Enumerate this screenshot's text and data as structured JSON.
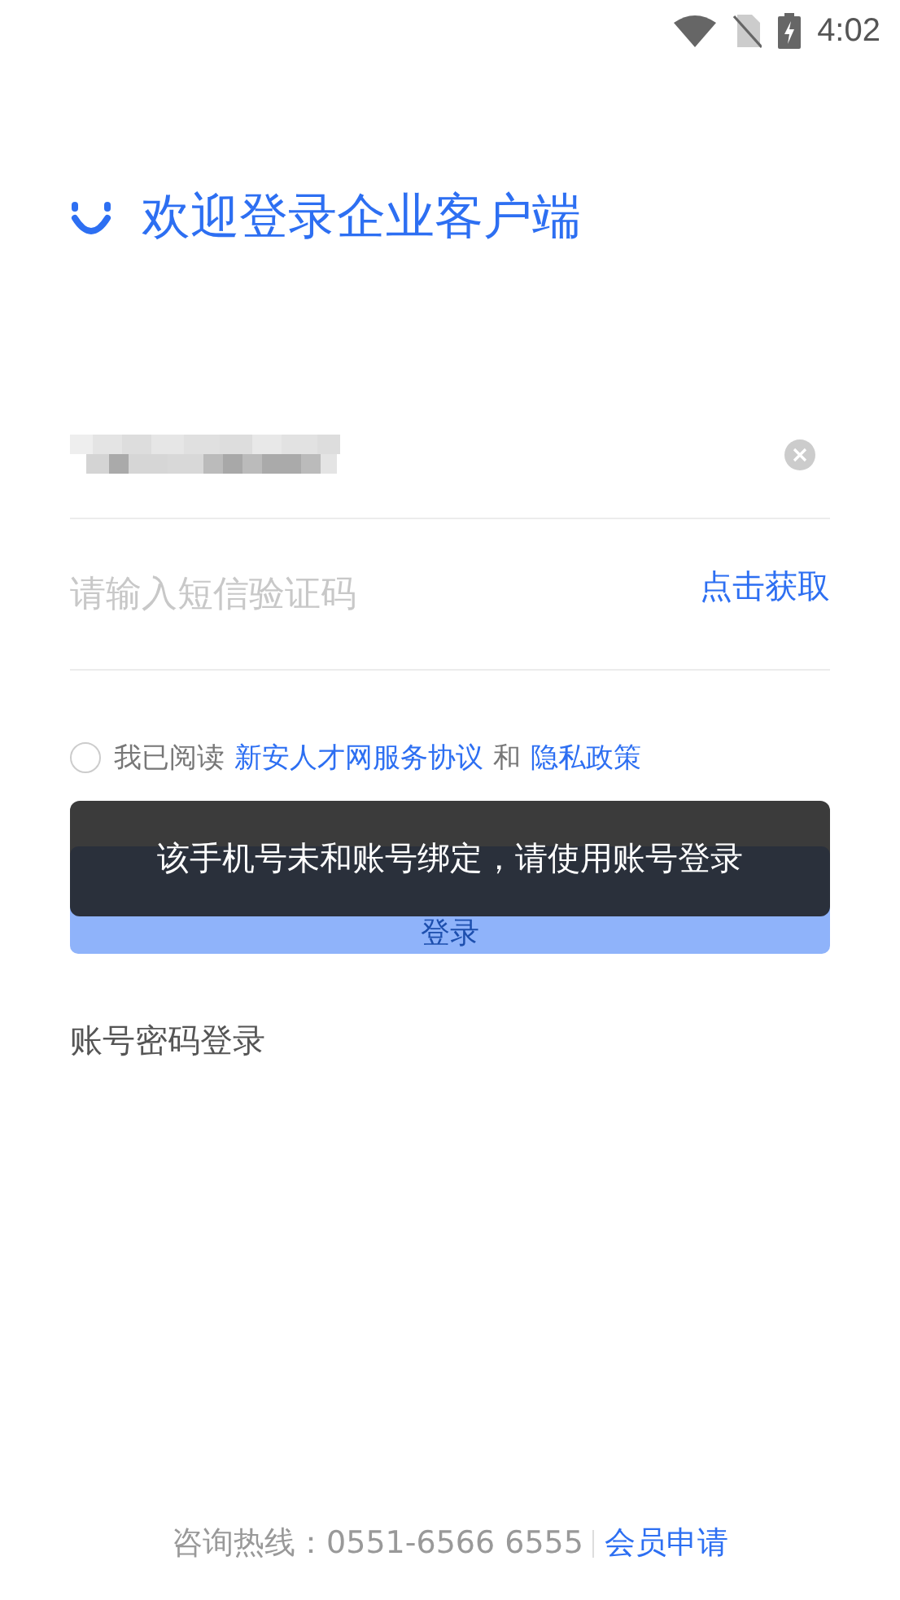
{
  "status_bar": {
    "time": "4:02"
  },
  "title": "欢迎登录企业客户端",
  "phone_field": {
    "value_redacted": true
  },
  "code_field": {
    "placeholder": "请输入短信验证码",
    "action": "点击获取"
  },
  "agreement": {
    "checked": false,
    "prefix": "我已阅读",
    "link_1": "新安人才网服务协议",
    "joiner": "和",
    "link_2": "隐私政策"
  },
  "login_button": {
    "label": "登录",
    "disabled": true
  },
  "toast": "该手机号未和账号绑定，请使用账号登录",
  "password_login": "账号密码登录",
  "footer": {
    "hotline": "咨询热线：0551-6566 6555",
    "link": "会员申请"
  }
}
